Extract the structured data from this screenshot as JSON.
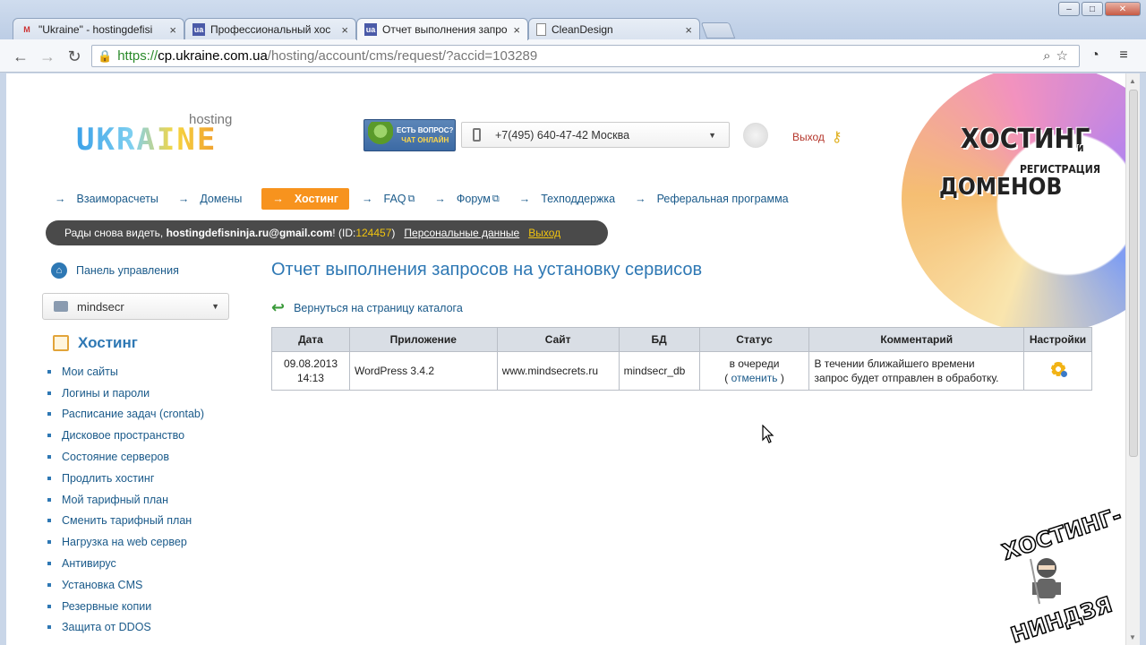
{
  "browser": {
    "tabs": [
      {
        "label": "\"Ukraine\" - hostingdefisi",
        "favicon": "M"
      },
      {
        "label": "Профессиональный хос",
        "favicon": "ua"
      },
      {
        "label": "Отчет выполнения запро",
        "favicon": "ua"
      },
      {
        "label": "CleanDesign",
        "favicon": ""
      }
    ],
    "url": {
      "scheme": "https://",
      "host": "cp.ukraine.com.ua",
      "path": "/hosting/account/cms/request/?accid=103289"
    }
  },
  "header": {
    "logo_small": "hosting",
    "logo_big": "UKRAINE",
    "chat_line1": "есть вопрос?",
    "chat_line2": "чат онлайн",
    "phone": "+7(495) 640-47-42 Москва",
    "logout": "Выход",
    "hero_line1": "ХОСТИНГ",
    "hero_and": "и",
    "hero_line2": "РЕГИСТРАЦИЯ",
    "hero_line3": "ДОМЕНОВ"
  },
  "nav": {
    "items": [
      {
        "label": "Взаиморасчеты"
      },
      {
        "label": "Домены"
      },
      {
        "label": "Хостинг"
      },
      {
        "label": "FAQ"
      },
      {
        "label": "Форум"
      },
      {
        "label": "Техподдержка"
      },
      {
        "label": "Реферальная программа"
      }
    ]
  },
  "userbar": {
    "greeting": "Рады снова видеть,",
    "email": "hostingdefisninja.ru@gmail.com",
    "excl": "!",
    "id_prefix": "(ID:",
    "id": "124457",
    "id_suffix": ")",
    "personal": "Персональные данные",
    "exit": "Выход"
  },
  "sidebar": {
    "home": "Панель управления",
    "site_select": "mindsecr",
    "heading": "Хостинг",
    "items": [
      "Мои сайты",
      "Логины и пароли",
      "Расписание задач (crontab)",
      "Дисковое пространство",
      "Состояние серверов",
      "Продлить хостинг",
      "Мой тарифный план",
      "Сменить тарифный план",
      "Нагрузка на web сервер",
      "Антивирус",
      "Установка CMS",
      "Резервные копии",
      "Защита от DDOS"
    ]
  },
  "content": {
    "title": "Отчет выполнения запросов на установку сервисов",
    "back_link": "Вернуться на страницу каталога",
    "table": {
      "headers": [
        "Дата",
        "Приложение",
        "Сайт",
        "БД",
        "Статус",
        "Комментарий",
        "Настройки"
      ],
      "rows": [
        {
          "date": "09.08.2013",
          "time": "14:13",
          "app": "WordPress 3.4.2",
          "site": "www.mindsecrets.ru",
          "db": "mindsecr_db",
          "status": "в очереди",
          "cancel_open": "(",
          "cancel": "отменить",
          "cancel_close": ")",
          "comment_line1": "В течении ближайшего времени",
          "comment_line2": "запрос будет отправлен в обработку."
        }
      ]
    }
  },
  "watermark": {
    "line1": "ХОСТИНГ-",
    "line2": "НИНДЗЯ"
  },
  "colors": {
    "accent": "#f7931e",
    "link": "#1a5a8a",
    "title": "#2e78b4",
    "userbar": "#4a4a4a",
    "highlight": "#f1c40f"
  }
}
